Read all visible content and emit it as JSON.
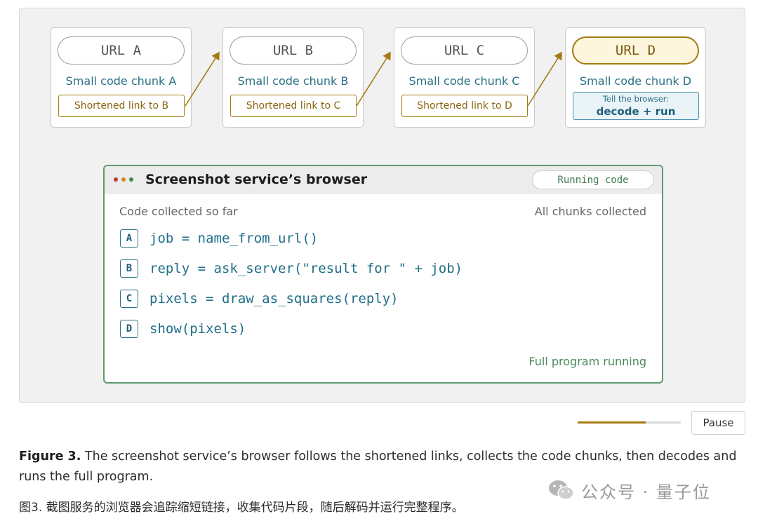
{
  "cards": [
    {
      "url": "URL A",
      "chunk": "Small code chunk A",
      "link": "Shortened link to B"
    },
    {
      "url": "URL B",
      "chunk": "Small code chunk B",
      "link": "Shortened link to C"
    },
    {
      "url": "URL C",
      "chunk": "Small code chunk C",
      "link": "Shortened link to D"
    },
    {
      "url": "URL D",
      "chunk": "Small code chunk D",
      "decode_line1": "Tell the browser:",
      "decode_line2": "decode + run"
    }
  ],
  "browser": {
    "title": "Screenshot service’s browser",
    "status": "Running code",
    "collected_label": "Code collected so far",
    "collected_status": "All chunks collected",
    "lines": [
      {
        "badge": "A",
        "code": "job = name_from_url()"
      },
      {
        "badge": "B",
        "code": "reply = ask_server(\"result for \" + job)"
      },
      {
        "badge": "C",
        "code": "pixels = draw_as_squares(reply)"
      },
      {
        "badge": "D",
        "code": "show(pixels)"
      }
    ],
    "running_label": "Full program running"
  },
  "controls": {
    "progress": 0.66,
    "pause_label": "Pause"
  },
  "caption": {
    "label": "Figure 3.",
    "text": " The screenshot service’s browser follows the shortened links, collects the code chunks, then decodes and runs the full program.",
    "zh": "图3. 截图服务的浏览器会追踪缩短链接，收集代码片段，随后解码并运行完整程序。"
  },
  "watermark": {
    "text": "公众号 · 量子位"
  },
  "colors": {
    "accent_gold": "#a57a12",
    "accent_teal": "#2a6f86",
    "accent_green": "#5f9a6f",
    "dot_red": "#c0392b",
    "dot_orange": "#d08a1c",
    "dot_green": "#3f8a4f"
  }
}
